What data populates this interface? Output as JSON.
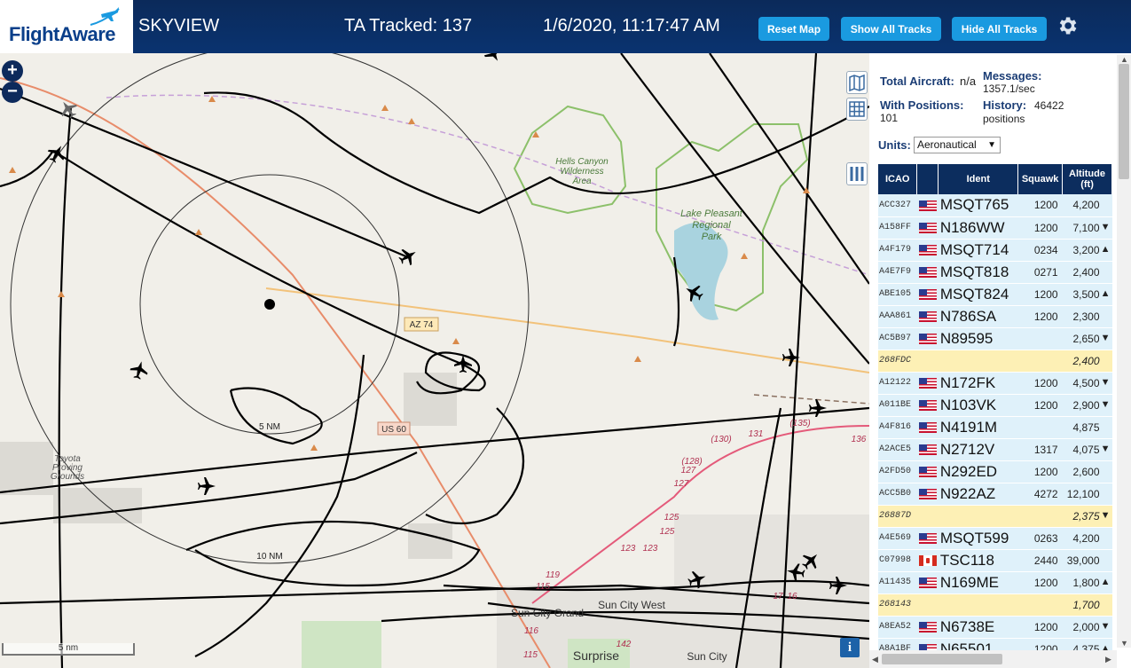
{
  "header": {
    "logo_text": "FlightAware",
    "site_name": "SKYVIEW",
    "ta_tracked": "TA Tracked: 137",
    "clock": "1/6/2020, 11:17:47 AM",
    "reset_map_label": "Reset Map",
    "show_all_tracks_label": "Show All Tracks",
    "hide_all_tracks_label": "Hide All Tracks",
    "settings_icon": "gear-icon"
  },
  "map": {
    "zoom_in": "+",
    "zoom_out": "−",
    "scale_label": "5 nm",
    "info_label": "i",
    "place_labels": {
      "hells_canyon": [
        "Hells Canyon",
        "Wilderness",
        "Area"
      ],
      "lake_pleasant": [
        "Lake Pleasant",
        "Regional",
        "Park"
      ],
      "toyota": [
        "Toyota",
        "Proving",
        "Grounds"
      ],
      "sun_city_grand": "Sun City Grand",
      "sun_city_west": "Sun City West",
      "surprise": "Surprise",
      "sun_city": "Sun City"
    },
    "road_labels": {
      "az74": "AZ 74",
      "us60": "US 60"
    },
    "ring_labels": {
      "r5": "5 NM",
      "r10": "10 NM"
    },
    "route_numbers": [
      "(135)",
      "(130)",
      "131",
      "(128)",
      "127",
      "127",
      "125",
      "125",
      "123",
      "123",
      "119",
      "115",
      "116",
      "115",
      "142",
      "17",
      "16",
      "136"
    ],
    "layer_icons": [
      "map-icon",
      "grid-icon",
      "columns-icon"
    ]
  },
  "panel": {
    "total_aircraft_label": "Total Aircraft:",
    "total_aircraft_value": "n/a",
    "messages_label": "Messages:",
    "messages_value": "1357.1/sec",
    "with_positions_label": "With Positions:",
    "with_positions_value": "101",
    "history_label": "History:",
    "history_value_a": "46422",
    "history_value_b": "positions",
    "units_label": "Units:",
    "units_value": "Aeronautical",
    "columns": {
      "icao": "ICAO",
      "ident": "Ident",
      "squawk": "Squawk",
      "altitude": "Altitude",
      "altitude_unit": "(ft)"
    }
  },
  "aircraft": [
    {
      "icao": "ACC327",
      "flag": "us",
      "ident": "MSQT765",
      "squawk": "1200",
      "alt": "4,200",
      "trend": "",
      "highlight": false
    },
    {
      "icao": "A158FF",
      "flag": "us",
      "ident": "N186WW",
      "squawk": "1200",
      "alt": "7,100",
      "trend": "▼",
      "highlight": false
    },
    {
      "icao": "A4F179",
      "flag": "us",
      "ident": "MSQT714",
      "squawk": "0234",
      "alt": "3,200",
      "trend": "▲",
      "highlight": false
    },
    {
      "icao": "A4E7F9",
      "flag": "us",
      "ident": "MSQT818",
      "squawk": "0271",
      "alt": "2,400",
      "trend": "",
      "highlight": false
    },
    {
      "icao": "ABE105",
      "flag": "us",
      "ident": "MSQT824",
      "squawk": "1200",
      "alt": "3,500",
      "trend": "▲",
      "highlight": false
    },
    {
      "icao": "AAA861",
      "flag": "us",
      "ident": "N786SA",
      "squawk": "1200",
      "alt": "2,300",
      "trend": "",
      "highlight": false
    },
    {
      "icao": "AC5B97",
      "flag": "us",
      "ident": "N89595",
      "squawk": "",
      "alt": "2,650",
      "trend": "▼",
      "highlight": false
    },
    {
      "icao": "268FDC",
      "flag": "",
      "ident": "",
      "squawk": "",
      "alt": "2,400",
      "trend": "",
      "highlight": true
    },
    {
      "icao": "A12122",
      "flag": "us",
      "ident": "N172FK",
      "squawk": "1200",
      "alt": "4,500",
      "trend": "▼",
      "highlight": false
    },
    {
      "icao": "A011BE",
      "flag": "us",
      "ident": "N103VK",
      "squawk": "1200",
      "alt": "2,900",
      "trend": "▼",
      "highlight": false
    },
    {
      "icao": "A4F816",
      "flag": "us",
      "ident": "N4191M",
      "squawk": "",
      "alt": "4,875",
      "trend": "",
      "highlight": false
    },
    {
      "icao": "A2ACE5",
      "flag": "us",
      "ident": "N2712V",
      "squawk": "1317",
      "alt": "4,075",
      "trend": "▼",
      "highlight": false
    },
    {
      "icao": "A2FD50",
      "flag": "us",
      "ident": "N292ED",
      "squawk": "1200",
      "alt": "2,600",
      "trend": "",
      "highlight": false
    },
    {
      "icao": "ACC5B0",
      "flag": "us",
      "ident": "N922AZ",
      "squawk": "4272",
      "alt": "12,100",
      "trend": "",
      "highlight": false
    },
    {
      "icao": "26887D",
      "flag": "",
      "ident": "",
      "squawk": "",
      "alt": "2,375",
      "trend": "▼",
      "highlight": true
    },
    {
      "icao": "A4E569",
      "flag": "us",
      "ident": "MSQT599",
      "squawk": "0263",
      "alt": "4,200",
      "trend": "",
      "highlight": false
    },
    {
      "icao": "C07998",
      "flag": "ca",
      "ident": "TSC118",
      "squawk": "2440",
      "alt": "39,000",
      "trend": "",
      "highlight": false
    },
    {
      "icao": "A11435",
      "flag": "us",
      "ident": "N169ME",
      "squawk": "1200",
      "alt": "1,800",
      "trend": "▲",
      "highlight": false
    },
    {
      "icao": "268143",
      "flag": "",
      "ident": "",
      "squawk": "",
      "alt": "1,700",
      "trend": "",
      "highlight": true
    },
    {
      "icao": "A8EA52",
      "flag": "us",
      "ident": "N6738E",
      "squawk": "1200",
      "alt": "2,000",
      "trend": "▼",
      "highlight": false
    },
    {
      "icao": "A8A1BF",
      "flag": "us",
      "ident": "N65501",
      "squawk": "1200",
      "alt": "4,375",
      "trend": "▲",
      "highlight": false
    }
  ],
  "colors": {
    "header_bg": "#0b2a5a",
    "button_bg": "#1a9ae0",
    "row_bg": "#dff1fa",
    "row_highlight_bg": "#fdf0b5",
    "track": "#000000",
    "highway": "#e88c6a",
    "state_route": "#f2c27a",
    "lake": "#a9d3df",
    "park_border": "#8cc06a"
  }
}
